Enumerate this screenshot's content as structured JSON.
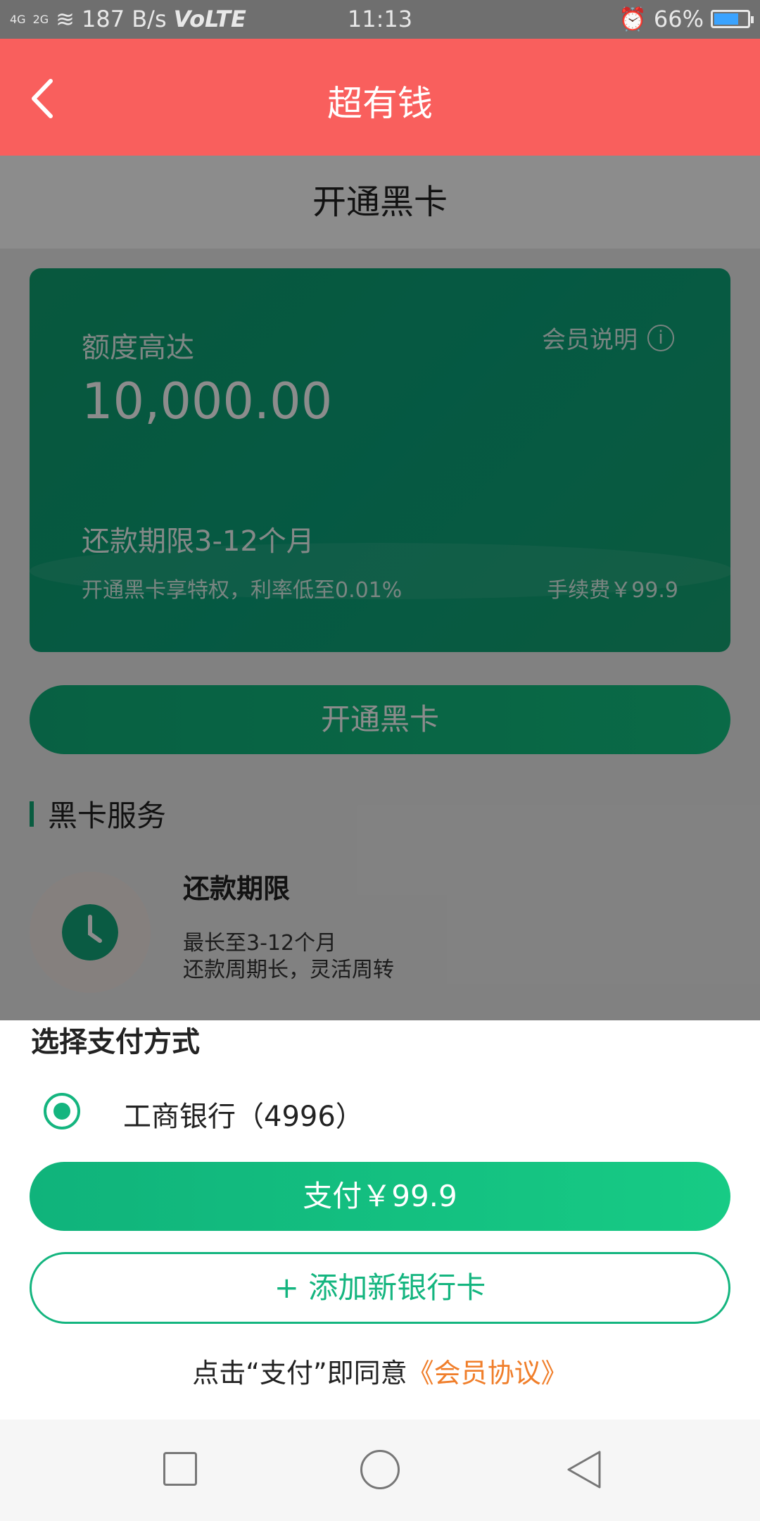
{
  "status_bar": {
    "signal_left": "4G",
    "signal_right": "2G",
    "speed": "187 B/s",
    "volte": "VoLTE",
    "time": "11:13",
    "battery": "66%"
  },
  "app_bar": {
    "title": "超有钱"
  },
  "page": {
    "subheader": "开通黑卡",
    "card": {
      "amount_label": "额度高达",
      "amount": "10,000.00",
      "info_label": "会员说明",
      "info_icon": "i",
      "term": "还款期限3-12个月",
      "privilege": "开通黑卡享特权，利率低至0.01%",
      "fee": "手续费￥99.9"
    },
    "open_button": "开通黑卡",
    "section_title": "黑卡服务",
    "service": {
      "title": "还款期限",
      "desc_line1": "最长至3-12个月",
      "desc_line2": "还款周期长，灵活周转"
    }
  },
  "sheet": {
    "title": "选择支付方式",
    "bank": "工商银行（4996）",
    "pay_button": "支付￥99.9",
    "add_button": "+ 添加新银行卡",
    "agree_prefix": "点击“支付”即同意",
    "agree_link": "《会员协议》"
  },
  "colors": {
    "header": "#f95f5d",
    "primary_green": "#14b57f",
    "link_orange": "#f07e2a"
  }
}
